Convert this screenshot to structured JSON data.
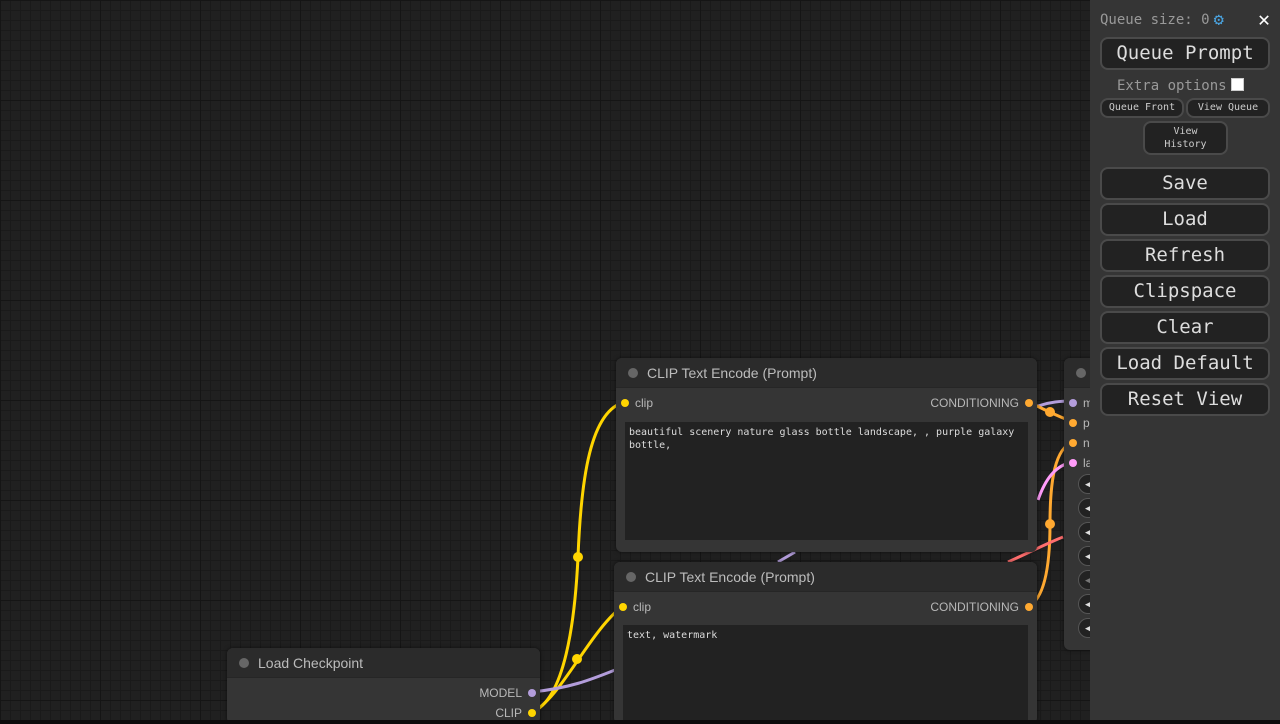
{
  "nodes": {
    "clip_top": {
      "title": "CLIP Text Encode (Prompt)",
      "input": "clip",
      "output": "CONDITIONING",
      "text": "beautiful scenery nature glass bottle landscape, , purple galaxy bottle,"
    },
    "clip_bottom": {
      "title": "CLIP Text Encode (Prompt)",
      "input": "clip",
      "output": "CONDITIONING",
      "text": "text, watermark"
    },
    "load_checkpoint": {
      "title": "Load Checkpoint",
      "outputs": [
        "MODEL",
        "CLIP"
      ]
    },
    "ksampler_partial": {
      "inputs": [
        "m",
        "p",
        "n",
        "la"
      ],
      "widget_arrow": "◀"
    }
  },
  "menu": {
    "queue_size_label": "Queue size: 0",
    "queue_prompt": "Queue Prompt",
    "extra_options": "Extra options",
    "queue_front": "Queue Front",
    "view_queue": "View Queue",
    "view_history": "View History",
    "save": "Save",
    "load": "Load",
    "refresh": "Refresh",
    "clipspace": "Clipspace",
    "clear": "Clear",
    "load_default": "Load Default",
    "reset_view": "Reset View",
    "close_glyph": "✕",
    "gear_glyph": "⚙"
  },
  "colors": {
    "clip_wire": "#ffd500",
    "model_wire": "#b39ddb",
    "conditioning_wire": "#ffa931",
    "latent_wire": "#ff9cf9",
    "vae_wire": "#ff6e6e"
  }
}
